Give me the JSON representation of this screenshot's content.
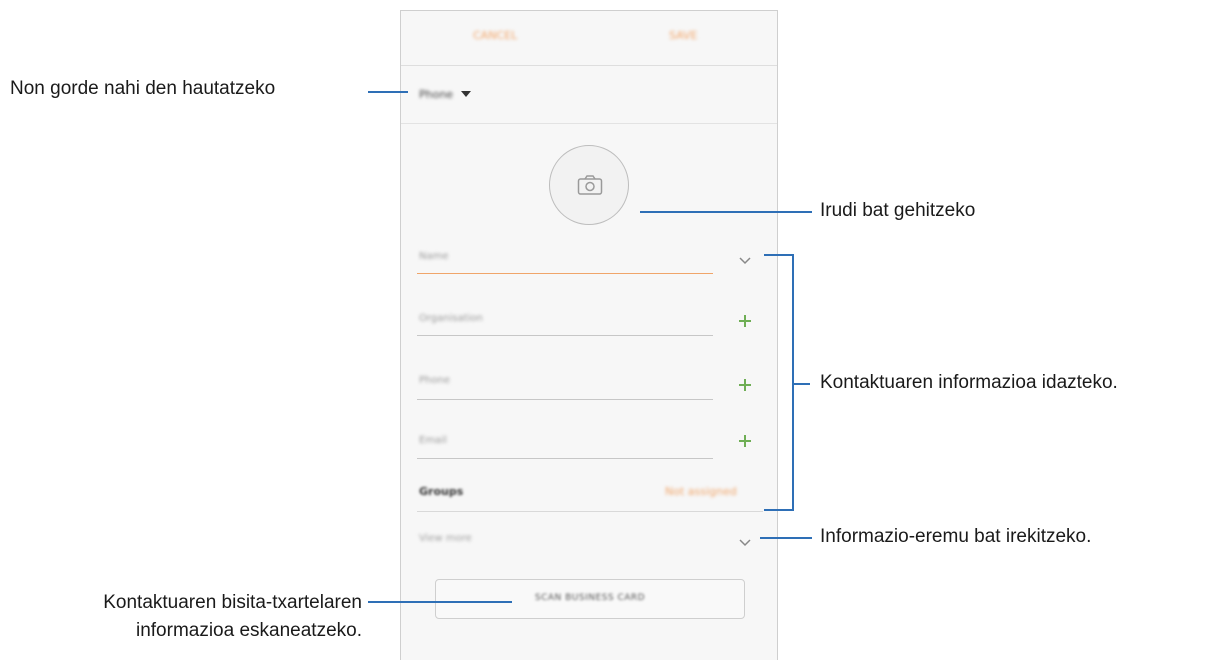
{
  "phone": {
    "top_bar": {
      "cancel_label": "CANCEL",
      "save_label": "SAVE"
    },
    "storage": {
      "label": "Phone",
      "icon": "dropdown-caret-icon"
    },
    "photo": {
      "icon": "camera-icon"
    },
    "fields": [
      {
        "placeholder": "Name",
        "action_icon": "chevron-down-icon"
      },
      {
        "placeholder": "Organisation",
        "action_icon": "plus-icon"
      },
      {
        "placeholder": "Phone",
        "action_icon": "plus-icon"
      },
      {
        "placeholder": "Email",
        "action_icon": "plus-icon"
      }
    ],
    "groups": {
      "label": "Groups",
      "value": "Not assigned"
    },
    "view_more": {
      "label": "View more",
      "icon": "chevron-down-icon"
    },
    "scan_button": {
      "label": "SCAN BUSINESS CARD"
    },
    "colors": {
      "accent": "#f0a56a",
      "plus": "#6fae55",
      "callout_line": "#2e6fb6"
    }
  },
  "callouts": {
    "storage": "Non gorde nahi den hautatzeko",
    "image": "Irudi bat gehitzeko",
    "contact_info": "Kontaktuaren informazioa idazteko.",
    "open_field": "Informazio-eremu bat irekitzeko.",
    "scan_line1": "Kontaktuaren bisita-txartelaren",
    "scan_line2": "informazioa eskaneatzeko."
  }
}
